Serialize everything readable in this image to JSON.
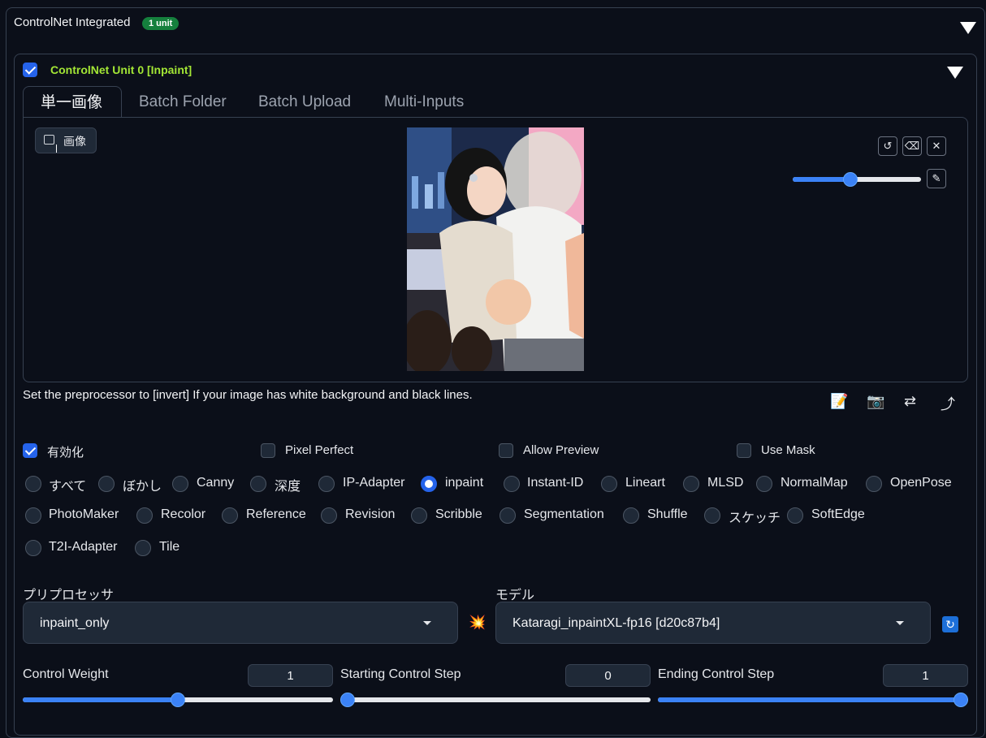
{
  "accordion": {
    "title": "ControlNet Integrated",
    "badge": "1 unit"
  },
  "unit": {
    "title": "ControlNet Unit 0  [Inpaint]",
    "enabled": true
  },
  "tabs": [
    "単一画像",
    "Batch Folder",
    "Batch Upload",
    "Multi-Inputs"
  ],
  "active_tab": 0,
  "image_input": {
    "label": "画像",
    "brush_size_percent": 45,
    "buttons": [
      "undo-icon",
      "eraser-icon",
      "close-icon",
      "brush-icon"
    ]
  },
  "hint": "Set the preprocessor to [invert] If your image has white background and black lines.",
  "tools": {
    "edit": "📝",
    "camera": "📷",
    "swap": "⇄",
    "send": "⤴"
  },
  "options": [
    {
      "label": "有効化",
      "checked": true
    },
    {
      "label": "Pixel Perfect",
      "checked": false
    },
    {
      "label": "Allow Preview",
      "checked": false
    },
    {
      "label": "Use Mask",
      "checked": false
    }
  ],
  "control_types": [
    "すべて",
    "ぼかし",
    "Canny",
    "深度",
    "IP-Adapter",
    "inpaint",
    "Instant-ID",
    "Lineart",
    "MLSD",
    "NormalMap",
    "OpenPose",
    "PhotoMaker",
    "Recolor",
    "Reference",
    "Revision",
    "Scribble",
    "Segmentation",
    "Shuffle",
    "スケッチ",
    "SoftEdge",
    "T2I-Adapter",
    "Tile"
  ],
  "selected_control_type": "inpaint",
  "preprocessor": {
    "label": "プリプロセッサ",
    "value": "inpaint_only",
    "run_icon": "💥"
  },
  "model": {
    "label": "モデル",
    "value": "Kataragi_inpaintXL-fp16 [d20c87b4]",
    "refresh_icon": "🔄"
  },
  "sliders": [
    {
      "label": "Control Weight",
      "value": "1",
      "fill_fraction": 0.5
    },
    {
      "label": "Starting Control Step",
      "value": "0",
      "fill_fraction": 0
    },
    {
      "label": "Ending Control Step",
      "value": "1",
      "fill_fraction": 1
    }
  ],
  "colors": {
    "accent": "#2563eb",
    "unit_title": "#a3e635",
    "badge": "#15803d",
    "background": "#0b0f19"
  }
}
